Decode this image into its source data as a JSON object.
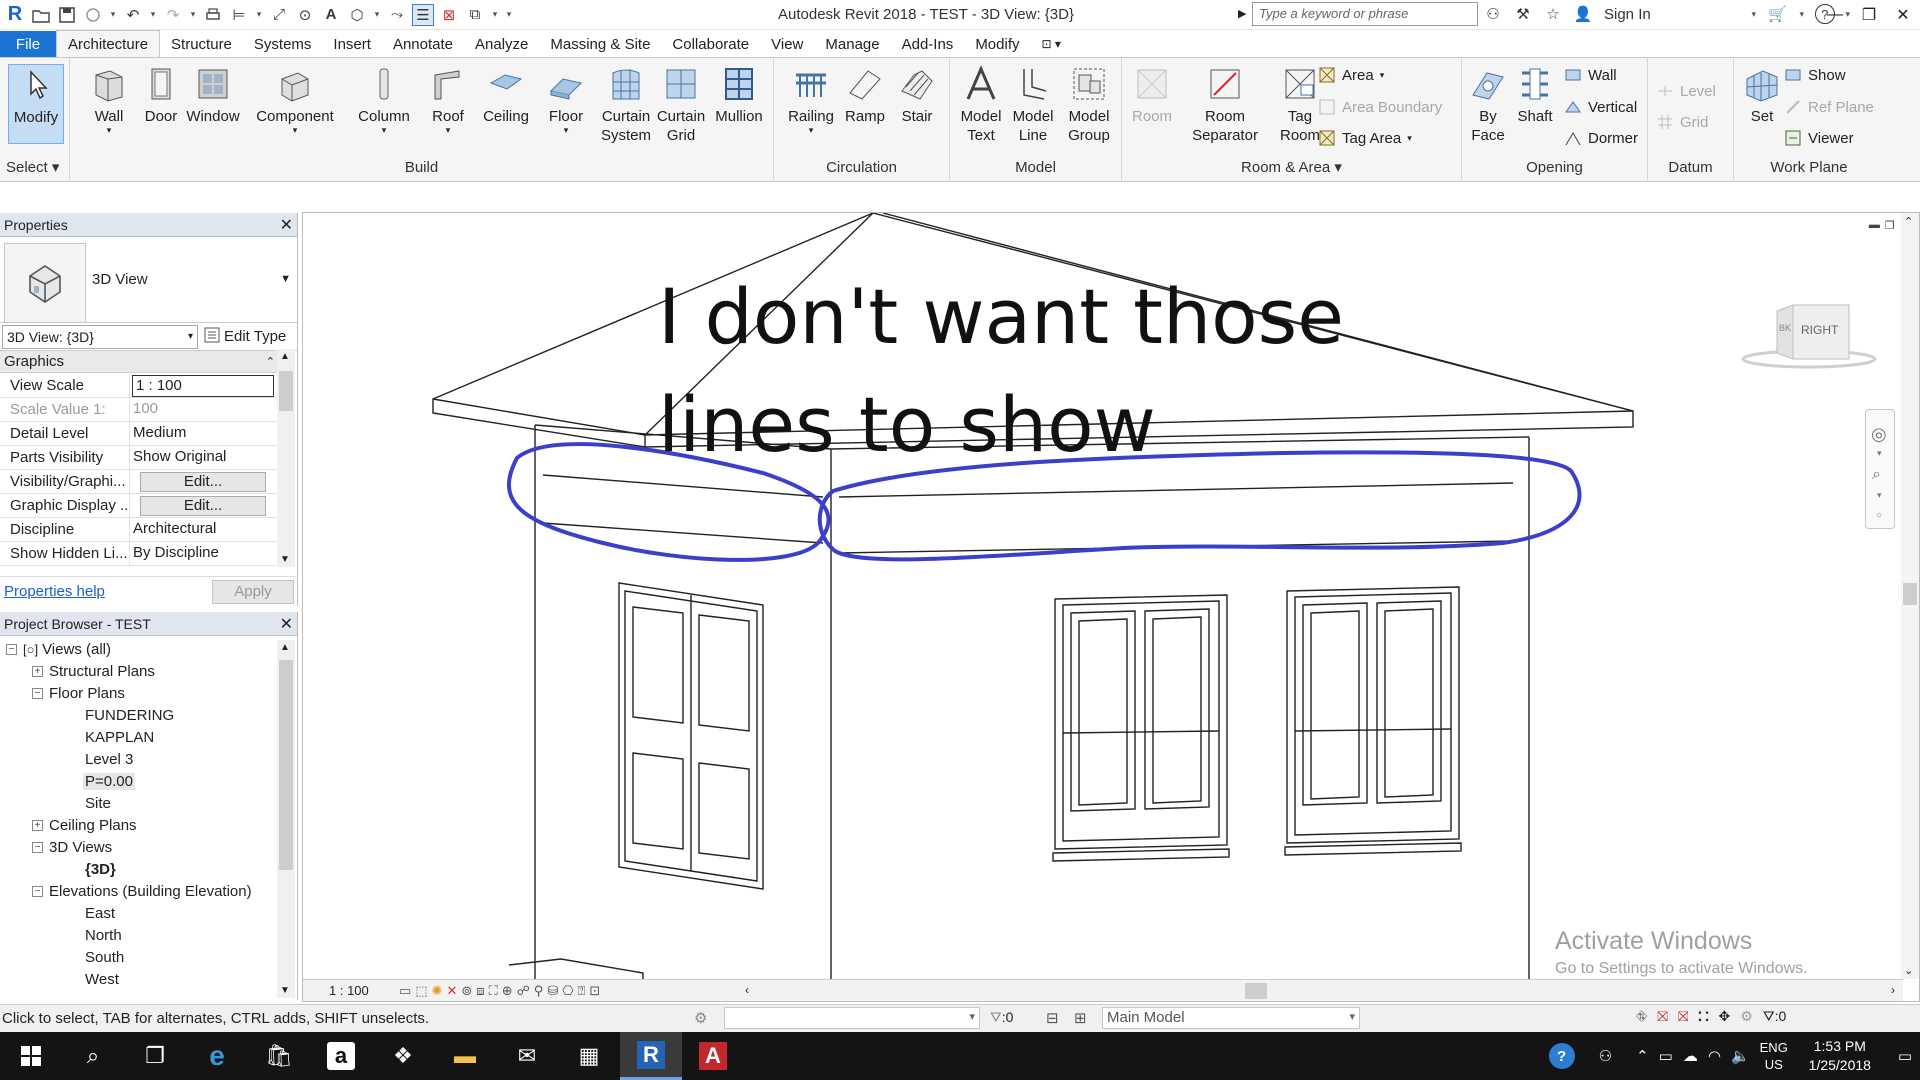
{
  "title_bar": {
    "app_title": "Autodesk Revit 2018 -     TEST - 3D View: {3D}",
    "search_placeholder": "Type a keyword or phrase",
    "sign_in": "Sign In"
  },
  "menu_tabs": [
    {
      "label": "File"
    },
    {
      "label": "Architecture"
    },
    {
      "label": "Structure"
    },
    {
      "label": "Systems"
    },
    {
      "label": "Insert"
    },
    {
      "label": "Annotate"
    },
    {
      "label": "Analyze"
    },
    {
      "label": "Massing & Site"
    },
    {
      "label": "Collaborate"
    },
    {
      "label": "View"
    },
    {
      "label": "Manage"
    },
    {
      "label": "Add-Ins"
    },
    {
      "label": "Modify"
    }
  ],
  "ribbon": {
    "select": {
      "modify": "Modify",
      "label": "Select"
    },
    "build": {
      "label": "Build",
      "wall": "Wall",
      "door": "Door",
      "window": "Window",
      "component": "Component",
      "column": "Column",
      "roof": "Roof",
      "ceiling": "Ceiling",
      "floor": "Floor",
      "curtain_system_1": "Curtain",
      "curtain_system_2": "System",
      "curtain_grid_1": "Curtain",
      "curtain_grid_2": "Grid",
      "mullion": "Mullion"
    },
    "circulation": {
      "label": "Circulation",
      "railing": "Railing",
      "ramp": "Ramp",
      "stair": "Stair"
    },
    "model": {
      "label": "Model",
      "model_text_1": "Model",
      "model_text_2": "Text",
      "model_line_1": "Model",
      "model_line_2": "Line",
      "model_group_1": "Model",
      "model_group_2": "Group"
    },
    "room_area": {
      "label": "Room & Area",
      "room": "Room",
      "room_sep_1": "Room",
      "room_sep_2": "Separator",
      "tag_room_1": "Tag",
      "tag_room_2": "Room",
      "area": "Area",
      "area_boundary": "Area  Boundary",
      "tag_area": "Tag  Area"
    },
    "opening": {
      "label": "Opening",
      "by_face_1": "By",
      "by_face_2": "Face",
      "shaft": "Shaft",
      "wall": "Wall",
      "vertical": "Vertical",
      "dormer": "Dormer"
    },
    "datum": {
      "label": "Datum",
      "level": "Level",
      "grid": "Grid"
    },
    "work_plane": {
      "label": "Work Plane",
      "set": "Set",
      "show": "Show",
      "ref_plane": "Ref  Plane",
      "viewer": "Viewer"
    }
  },
  "properties": {
    "title": "Properties",
    "type_name": "3D View",
    "instance": "3D View: {3D}",
    "edit_type": "Edit Type",
    "section": "Graphics",
    "rows": [
      {
        "key": "View Scale",
        "value": "1 : 100"
      },
      {
        "key": "Scale Value    1:",
        "value": "100"
      },
      {
        "key": "Detail Level",
        "value": "Medium"
      },
      {
        "key": "Parts Visibility",
        "value": "Show Original"
      },
      {
        "key": "Visibility/Graphi...",
        "value": "Edit..."
      },
      {
        "key": "Graphic Display ...",
        "value": "Edit..."
      },
      {
        "key": "Discipline",
        "value": "Architectural"
      },
      {
        "key": "Show Hidden Li...",
        "value": "By Discipline"
      }
    ],
    "help_link": "Properties help",
    "apply": "Apply"
  },
  "project_browser": {
    "title": "Project Browser - TEST",
    "nodes": [
      {
        "label": "Views (all)"
      },
      {
        "label": "Structural Plans"
      },
      {
        "label": "Floor Plans"
      },
      {
        "label": "FUNDERING"
      },
      {
        "label": "KAPPLAN"
      },
      {
        "label": "Level 3"
      },
      {
        "label": "P=0.00"
      },
      {
        "label": "Site"
      },
      {
        "label": "Ceiling Plans"
      },
      {
        "label": "3D Views"
      },
      {
        "label": "{3D}"
      },
      {
        "label": "Elevations (Building Elevation)"
      },
      {
        "label": "East"
      },
      {
        "label": "North"
      },
      {
        "label": "South"
      },
      {
        "label": "West"
      }
    ]
  },
  "viewport": {
    "annotation_line1": "I don't want those",
    "annotation_line2": "lines to show",
    "viewcube_face": "RIGHT",
    "scale": "1 : 100",
    "activate_title": "Activate Windows",
    "activate_sub": "Go to Settings to activate Windows."
  },
  "status_bar": {
    "hint": "Click to select, TAB for alternates, CTRL adds, SHIFT unselects.",
    "selection_count": ":0",
    "model": "Main Model",
    "filter_count": ":0"
  },
  "taskbar": {
    "lang_1": "ENG",
    "lang_2": "US",
    "time": "1:53 PM",
    "date": "1/25/2018"
  },
  "colors": {
    "file_tab": "#1c73d6",
    "annotation_ink": "#3b3fc9",
    "ribbon_bg": "#f5f5f5",
    "taskbar_bg": "#141414"
  }
}
